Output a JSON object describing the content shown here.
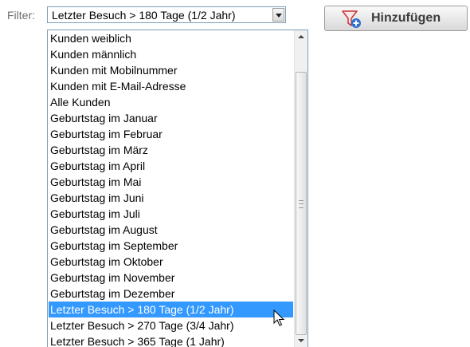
{
  "filter": {
    "label": "Filter:",
    "selected_value": "Letzter Besuch > 180 Tage (1/2 Jahr)"
  },
  "add_button": {
    "label": "Hinzufügen",
    "icon": "funnel-plus-icon"
  },
  "dropdown": {
    "options": [
      "Kunden weiblich",
      "Kunden männlich",
      "Kunden mit Mobilnummer",
      "Kunden mit E-Mail-Adresse",
      "Alle Kunden",
      "Geburtstag im Januar",
      "Geburtstag im Februar",
      "Geburtstag im März",
      "Geburtstag im April",
      "Geburtstag im Mai",
      "Geburtstag im Juni",
      "Geburtstag im Juli",
      "Geburtstag im August",
      "Geburtstag im September",
      "Geburtstag im Oktober",
      "Geburtstag im November",
      "Geburtstag im Dezember",
      "Letzter Besuch > 180 Tage (1/2 Jahr)",
      "Letzter Besuch > 270 Tage (3/4 Jahr)",
      "Letzter Besuch > 365 Tage (1 Jahr)"
    ],
    "highlighted_index": 17
  },
  "colors": {
    "highlight": "#3399ff",
    "border": "#7f9db9"
  }
}
